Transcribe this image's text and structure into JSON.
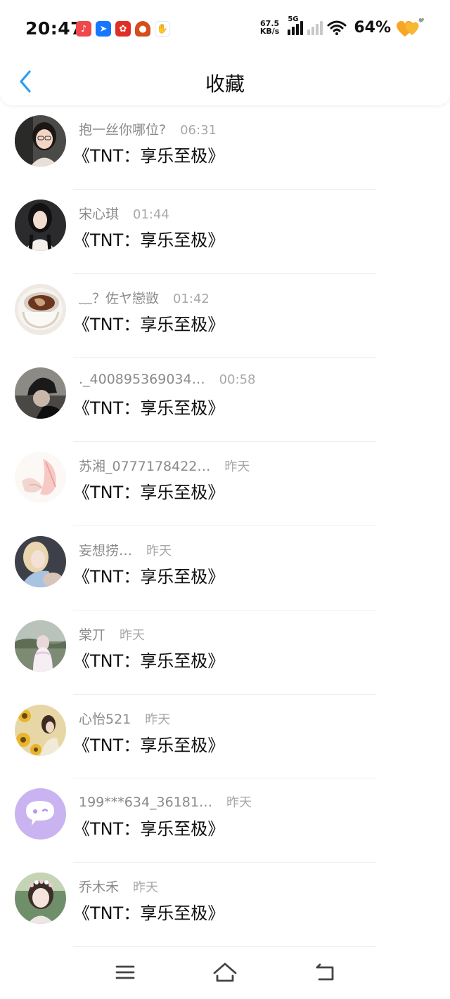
{
  "status_bar": {
    "time": "20:47",
    "net_speed_value": "67.5",
    "net_speed_unit": "KB/s",
    "network_type": "5G",
    "battery": "64%",
    "notification_apps": [
      {
        "icon": "music-app-icon",
        "color": "#f0474a"
      },
      {
        "icon": "feishu-app-icon",
        "color": "#1677ff"
      },
      {
        "icon": "pdd-app-icon",
        "color": "#e02e24"
      },
      {
        "icon": "game-app-icon",
        "color": "#d44d1c"
      },
      {
        "icon": "baidu-app-icon",
        "color": "#2f6fe4"
      }
    ]
  },
  "header": {
    "title": "收藏",
    "back_icon": "chevron-left-icon",
    "accent_color": "#2a9df4"
  },
  "favorites": [
    {
      "name": "抱一丝你哪位?",
      "time": "06:31",
      "content": "《TNT：享乐至极》",
      "avatar": "photo-girl-glasses"
    },
    {
      "name": "宋心琪",
      "time": "01:44",
      "content": "《TNT：享乐至极》",
      "avatar": "photo-girl-dark-hair"
    },
    {
      "name": "﹏？佐ヤ戀敳",
      "time": "01:42",
      "content": "《TNT：享乐至极》",
      "avatar": "photo-coffee-cup"
    },
    {
      "name": "._400895369034…",
      "time": "00:58",
      "content": "《TNT：享乐至极》",
      "avatar": "photo-dark-hat"
    },
    {
      "name": "苏湘_0777178422…",
      "time": "昨天",
      "content": "《TNT：享乐至极》",
      "avatar": "photo-pink-drawing"
    },
    {
      "name": "妄想捞…",
      "time": "昨天",
      "content": "《TNT：享乐至极》",
      "avatar": "photo-blonde-girl"
    },
    {
      "name": "棠丌",
      "time": "昨天",
      "content": "《TNT：享乐至极》",
      "avatar": "photo-white-dress"
    },
    {
      "name": "心怡521",
      "time": "昨天",
      "content": "《TNT：享乐至极》",
      "avatar": "photo-sunflowers"
    },
    {
      "name": "199***634_36181…",
      "time": "昨天",
      "content": "《TNT：享乐至极》",
      "avatar": "default-chat-bubble-avatar"
    },
    {
      "name": "乔木禾",
      "time": "昨天",
      "content": "《TNT：享乐至极》",
      "avatar": "photo-flower-crown"
    }
  ],
  "nav_bar": {
    "menu_icon": "menu-icon",
    "home_icon": "home-icon",
    "back_icon": "back-icon"
  }
}
